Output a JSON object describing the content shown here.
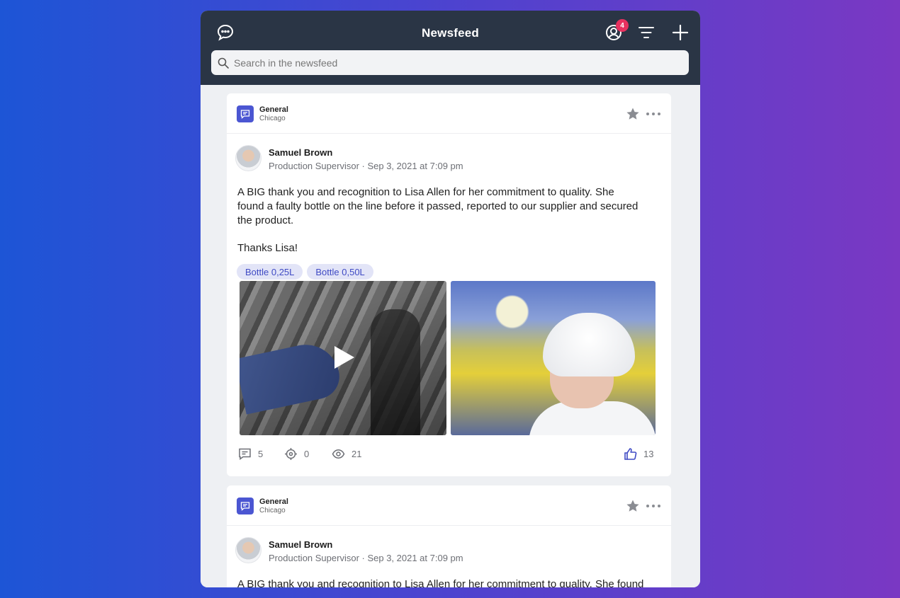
{
  "header": {
    "title": "Newsfeed",
    "notification_count": "4",
    "search_placeholder": "Search in the newsfeed"
  },
  "posts": [
    {
      "channel": "General",
      "location": "Chicago",
      "author": "Samuel Brown",
      "meta": "Production Supervisor · Sep 3, 2021 at 7:09 pm",
      "text": "A BIG thank you and recognition to Lisa Allen for her commitment to quality. She found a faulty bottle on the line before it passed, reported to our supplier and secured the product.",
      "thanks": "Thanks Lisa!",
      "tags": [
        "Bottle 0,25L",
        "Bottle 0,50L"
      ],
      "comments": "5",
      "targets": "0",
      "views": "21",
      "likes": "13"
    },
    {
      "channel": "General",
      "location": "Chicago",
      "author": "Samuel Brown",
      "meta": "Production Supervisor · Sep 3, 2021 at 7:09 pm",
      "text": "A BIG thank you and recognition to Lisa Allen for her commitment to quality. She found"
    }
  ],
  "colors": {
    "topbar": "#2a3545",
    "accent": "#4b56d2",
    "badge": "#e8315f",
    "like": "#3f4ac4"
  }
}
